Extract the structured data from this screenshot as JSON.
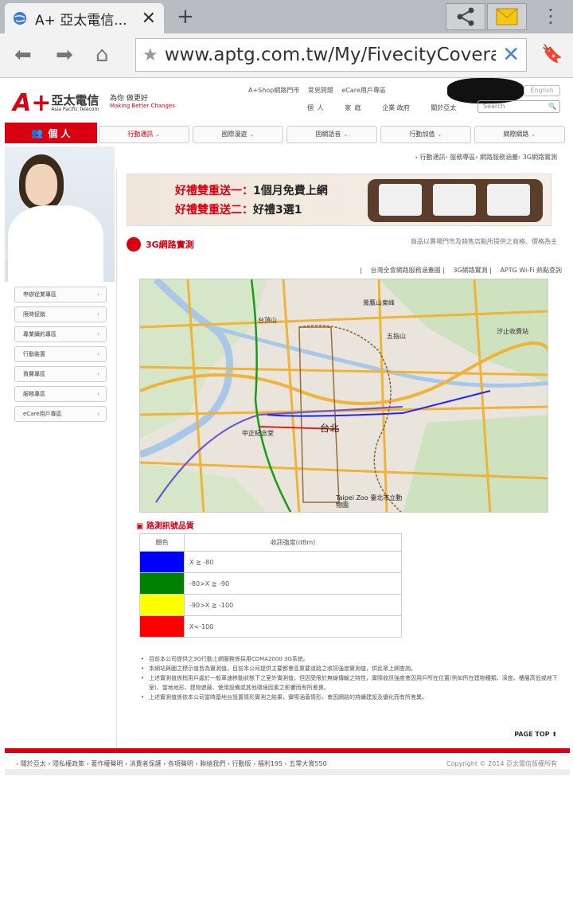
{
  "browser": {
    "tab_title": "A+ 亞太電信...",
    "url": "www.aptg.com.tw/My/FivecityCoverage.h"
  },
  "header": {
    "logo_cn": "亞太電信",
    "logo_en": "Asia Pacific Telecom",
    "slogan": "為你 做更好",
    "slogan_en": "Making Better Changes",
    "top_links": [
      "A+Shop網路門市",
      "常見問題",
      "eCare用戶專區"
    ],
    "english": "English",
    "sub_nav": [
      "個 人",
      "家 庭",
      "企業‧政府",
      "關於亞太"
    ],
    "search_placeholder": "Search"
  },
  "section_tab": "個 人",
  "main_nav": [
    "行動通訊",
    "國際漫遊",
    "固網語音",
    "行動加值",
    "網際網路"
  ],
  "breadcrumb": "› 行動通訊› 服務專區› 網路服務涵蓋› 3G網路實測",
  "side_menu": [
    "申辦從業專區",
    "限時促銷",
    "專業續約專區",
    "行動裝置",
    "資費專區",
    "服務專區",
    "eCare用戶專區"
  ],
  "banner": {
    "line1_a": "好禮雙重送一：",
    "line1_b": "1個月免費上網",
    "line2_a": "好禮雙重送二：",
    "line2_b": "好禮3選1"
  },
  "title": "3G網路實測",
  "title_note": "商品以賣場門市及銷售店點所提供之商格、價格為主",
  "links": [
    "台灣全會網路服務涵蓋圖",
    "3G網路實測",
    "APTG Wi-Fi 熱點查詢"
  ],
  "map": {
    "labels": [
      "台北",
      "中正紀念堂",
      "Taipei Zoo 臺北市立動物園",
      "汐止收費站",
      "鶯鷹山東峰",
      "五指山",
      "台頂山"
    ]
  },
  "quality_title": "路測訊號品質",
  "legend": {
    "headers": [
      "顏色",
      "收訊強度(dBm)"
    ],
    "rows": [
      {
        "color": "#0000ff",
        "label": "X ≧ -80"
      },
      {
        "color": "#008000",
        "label": "-80>X ≧ -90"
      },
      {
        "color": "#ffff00",
        "label": "-90>X ≧ -100"
      },
      {
        "color": "#ff0000",
        "label": "X<-100"
      }
    ]
  },
  "bullets": [
    "目前本公司提供之3G行動上網服務係採用CDMA2000 3G系統。",
    "本網站與圖之標示值皆為實測值，目前本公司提供主要都會區重要道路之收訊強度實測值，供民眾上網查詢。",
    "上述實測值係指用戶處於一般車速移動狀態下之室外實測值，但因受限於無線傳輸之特性，實際收訊強度會因用戶所在位置(例如所在建物種類、深度、樓層高低或地下室)、當地地形、建物遮蔽、使用設備或其他環境因素之影響而有所差異。",
    "上述實測值係依本公司當時基地台設置情形實測之結果，實際涵蓋情形，會因網路的持續建設及優化而有所差異。"
  ],
  "page_top": "PAGE TOP",
  "footer_links": [
    "關於亞太",
    "隱私權政策",
    "著作權聲明",
    "消費者保護",
    "各項聲明",
    "聯絡我們",
    "行動版",
    "福利195",
    "五零大賞550"
  ],
  "copyright": "Copyright © 2014 亞太電信版權所有"
}
